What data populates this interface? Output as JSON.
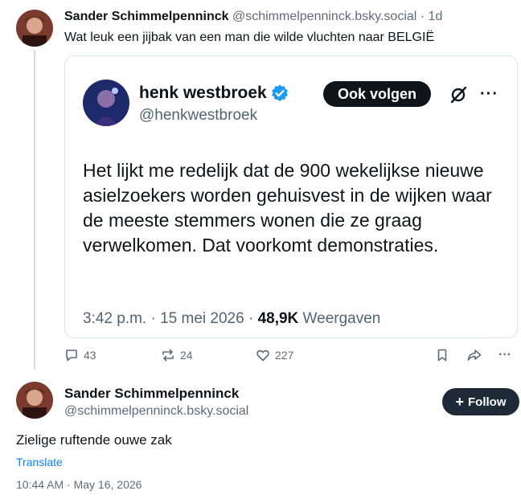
{
  "parent_post": {
    "author_name": "Sander Schimmelpenninck",
    "author_meta": " @schimmelpenninck.bsky.social · 1d",
    "text": "Wat leuk een jijbak van een man die wilde vluchten naar BELGIË",
    "quoted_image": {
      "name": "henk westbroek",
      "handle": "@henkwestbroek",
      "follow_label": "Ook volgen",
      "body": "Het lijkt me redelijk dat de 900 wekelijkse nieuwe asielzoekers worden gehuisvest in de wijken waar de meeste stemmers wonen die ze graag verwelkomen. Dat voorkomt demonstraties.",
      "time": "3:42 p.m. · 15 mei 2026 · ",
      "views_count": "48,9K",
      "views_label": " Weergaven"
    },
    "actions": {
      "replies": "43",
      "reposts": "24",
      "likes": "227"
    }
  },
  "reply_post": {
    "author_name": "Sander Schimmelpenninck",
    "author_handle": "@schimmelpenninck.bsky.social",
    "follow_label": "Follow",
    "text": "Zielige ruftende ouwe zak",
    "translate_label": "Translate",
    "timestamp": "10:44 AM · May 16, 2026"
  },
  "colors": {
    "accent": "#1083fe",
    "verified": "#1d9bf0",
    "muted": "#5e6c7a",
    "follow_bg": "#1e2a38"
  },
  "icons": [
    "avatar",
    "verified-badge-icon",
    "grok-icon",
    "more-icon",
    "reply-icon",
    "repost-icon",
    "like-icon",
    "bookmark-icon",
    "share-icon",
    "plus-icon"
  ]
}
